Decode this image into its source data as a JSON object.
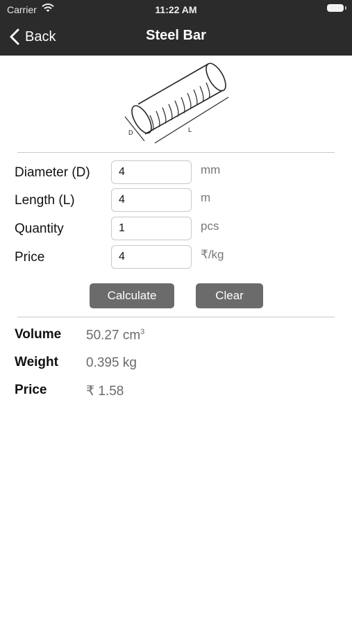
{
  "status_bar": {
    "carrier": "Carrier",
    "time": "11:22 AM"
  },
  "nav": {
    "back_label": "Back",
    "title": "Steel Bar"
  },
  "illustration": {
    "diameter_marker": "D",
    "length_marker": "L"
  },
  "inputs": [
    {
      "label": "Diameter (D)",
      "value": "4",
      "unit": "mm"
    },
    {
      "label": "Length (L)",
      "value": "4",
      "unit": "m"
    },
    {
      "label": "Quantity",
      "value": "1",
      "unit": "pcs"
    },
    {
      "label": "Price",
      "value": "4",
      "unit": "₹/kg"
    }
  ],
  "buttons": {
    "calculate": "Calculate",
    "clear": "Clear"
  },
  "results": {
    "volume_label": "Volume",
    "volume_value": "50.27 cm",
    "volume_superscript": "3",
    "weight_label": "Weight",
    "weight_value": "0.395 kg",
    "price_label": "Price",
    "price_value": "₹ 1.58"
  },
  "icons": {
    "back": "chevron-left-icon",
    "wifi": "wifi-icon",
    "battery": "battery-icon"
  },
  "colors": {
    "nav_background": "#2b2b2b",
    "button_background": "#6b6b6b",
    "result_value": "#6a6a6a"
  }
}
